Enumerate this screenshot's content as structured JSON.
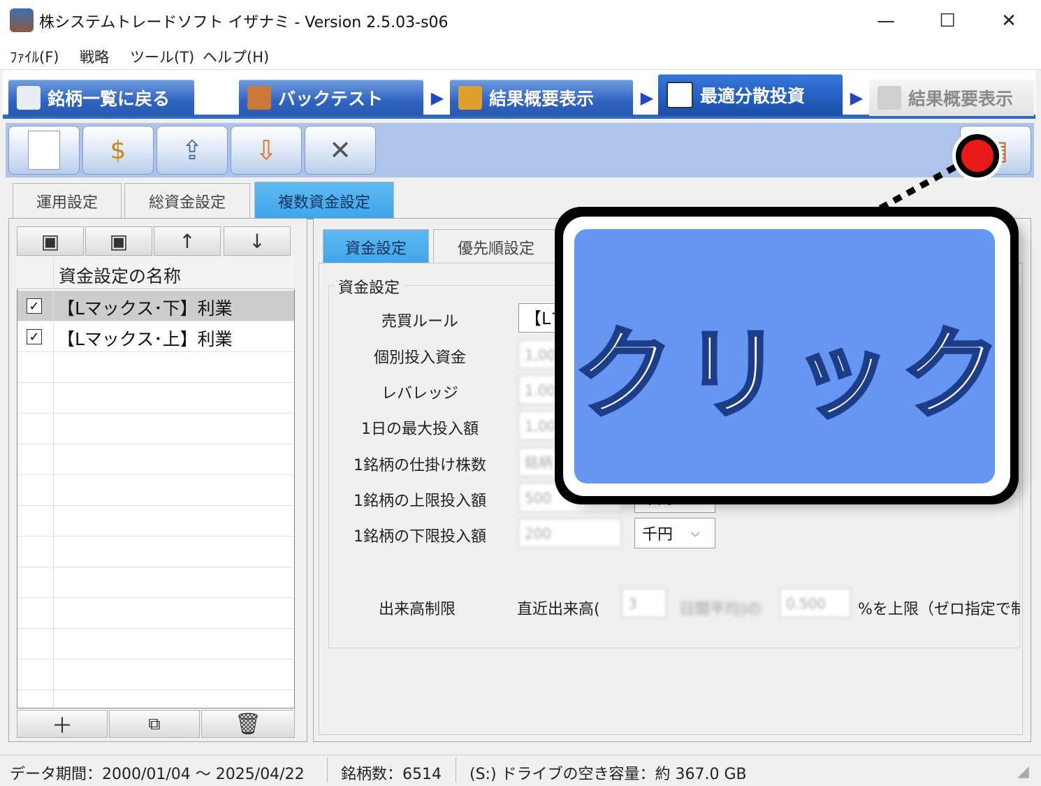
{
  "window": {
    "title": "株システムトレードソフト イザナミ - Version 2.5.03-s06",
    "minimize": "—",
    "maximize": "☐",
    "close": "✕"
  },
  "menu": [
    "ﾌｧｲﾙ(F)",
    "戦略",
    "ツール(T)",
    "ヘルプ(H)"
  ],
  "flow_tabs": [
    {
      "label": "銘柄一覧に戻る",
      "state": "normal"
    },
    {
      "label": "バックテスト",
      "state": "normal"
    },
    {
      "label": "結果概要表示",
      "state": "normal"
    },
    {
      "label": "最適分散投資",
      "state": "active"
    },
    {
      "label": "結果概要表示",
      "state": "disabled"
    }
  ],
  "toolbar": {
    "icons": [
      "new-document-icon",
      "fund-settings-icon",
      "export-icon",
      "import-icon",
      "tools-icon"
    ],
    "right_icon": "run-icon"
  },
  "setting_tabs": [
    "運用設定",
    "総資金設定",
    "複数資金設定"
  ],
  "left_panel": {
    "top_buttons": [
      "save-icon",
      "save-as-icon",
      "arrow-up-icon",
      "arrow-down-icon"
    ],
    "column_header": "資金設定の名称",
    "rows": [
      {
        "checked": "✓",
        "label": "【Lマックス･下】利業",
        "selected": true
      },
      {
        "checked": "✓",
        "label": "【Lマックス･上】利業",
        "selected": false
      }
    ],
    "bottom_buttons": [
      "plus-icon",
      "copy-icon",
      "trash-icon"
    ]
  },
  "inner_tabs": [
    "資金設定",
    "優先順設定"
  ],
  "fund_group": {
    "title": "資金設定",
    "fields": [
      {
        "label": "売買ルール",
        "value": "【Lマ"
      },
      {
        "label": "個別投入資金",
        "value": "1,00"
      },
      {
        "label": "レバレッジ",
        "value": "1.00"
      },
      {
        "label": "1日の最大投入額",
        "value": "1,00"
      },
      {
        "label": "1銘柄の仕掛け株数",
        "value": "銘柄"
      },
      {
        "label": "1銘柄の上限投入額",
        "value": "500"
      },
      {
        "label": "1銘柄の下限投入額",
        "value": "200"
      }
    ],
    "unit": "千円",
    "upper_unit": "千円",
    "volume": {
      "label": "出来高制限",
      "prefix": "直近出来高(",
      "days": "3",
      "mid": "日間平均)の",
      "percent": "0.500",
      "suffix": "%を上限（ゼロ指定で制"
    }
  },
  "callout": {
    "text": "クリック"
  },
  "status": {
    "period": "データ期間：2000/01/04 〜 2025/04/22",
    "count": "銘柄数：6514",
    "disk": "(S:) ドライブの空き容量：約 367.0 GB"
  }
}
